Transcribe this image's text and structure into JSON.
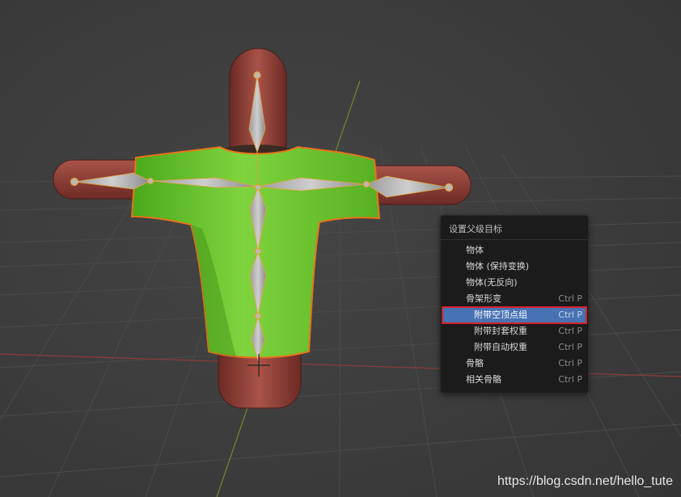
{
  "viewport": {
    "background": "#3d3d3d",
    "objects": [
      "body-mesh",
      "shirt-mesh",
      "armature"
    ]
  },
  "menu": {
    "title": "设置父级目标",
    "items": [
      {
        "label": "物体",
        "shortcut": ""
      },
      {
        "label": "物体 (保持变换)",
        "shortcut": ""
      },
      {
        "label": "物体(无反向)",
        "shortcut": ""
      },
      {
        "label": "骨架形变",
        "shortcut": "Ctrl P"
      },
      {
        "label": "附带空顶点组",
        "shortcut": "Ctrl P",
        "active": true
      },
      {
        "label": "附带封套权重",
        "shortcut": "Ctrl P"
      },
      {
        "label": "附带自动权重",
        "shortcut": "Ctrl P"
      },
      {
        "label": "骨骼",
        "shortcut": "Ctrl P"
      },
      {
        "label": "相关骨骼",
        "shortcut": "Ctrl P"
      }
    ],
    "colors": {
      "highlight": "#4772b3",
      "outline": "#d4212c"
    }
  },
  "watermark": "https://blog.csdn.net/hello_tute"
}
